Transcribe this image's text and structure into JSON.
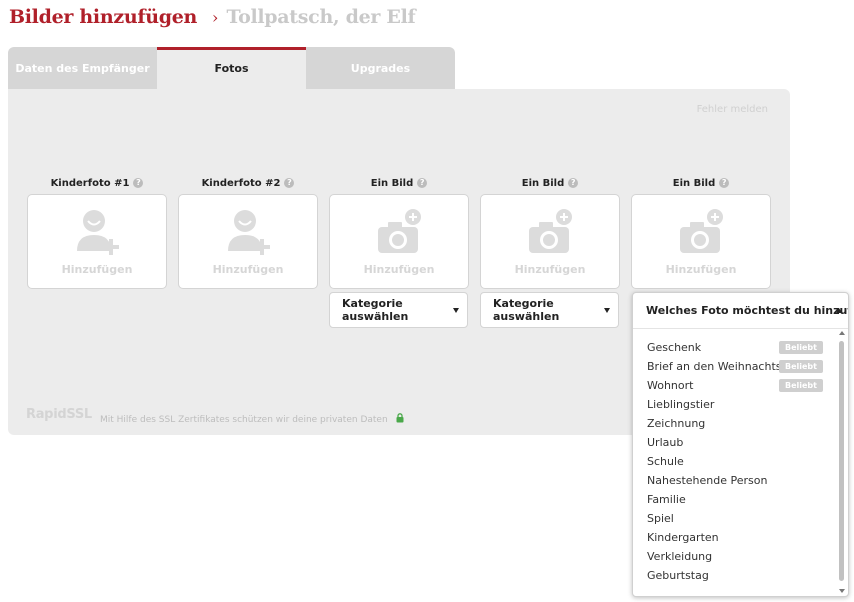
{
  "header": {
    "title": "Bilder hinzufügen",
    "separator": "›",
    "current": "Tollpatsch, der Elf"
  },
  "tabs": [
    {
      "label": "Daten des Empfänger",
      "active": false
    },
    {
      "label": "Fotos",
      "active": true
    },
    {
      "label": "Upgrades",
      "active": false
    }
  ],
  "panel": {
    "report_link": "Fehler melden",
    "help_glyph": "?",
    "slots": [
      {
        "label": "Kinderfoto #1",
        "add_label": "Hinzufügen",
        "icon": "child-photo-add-icon"
      },
      {
        "label": "Kinderfoto #2",
        "add_label": "Hinzufügen",
        "icon": "child-photo-add-icon"
      },
      {
        "label": "Ein Bild",
        "add_label": "Hinzufügen",
        "icon": "camera-add-icon",
        "category": "Kategorie auswählen"
      },
      {
        "label": "Ein Bild",
        "add_label": "Hinzufügen",
        "icon": "camera-add-icon",
        "category": "Kategorie auswählen"
      },
      {
        "label": "Ein Bild",
        "add_label": "Hinzufügen",
        "icon": "camera-add-icon"
      }
    ],
    "ssl_logo": "RapidSSL",
    "ssl_text": "Mit Hilfe des SSL Zertifikates schützen wir deine privaten Daten"
  },
  "dropdown": {
    "selected": "Welches Foto möchtest du hinzufüg…",
    "badge_label": "Beliebt",
    "options": [
      {
        "label": "Geschenk",
        "popular": true
      },
      {
        "label": "Brief an den Weihnachtsmann",
        "popular": true
      },
      {
        "label": "Wohnort",
        "popular": true
      },
      {
        "label": "Lieblingstier",
        "popular": false
      },
      {
        "label": "Zeichnung",
        "popular": false
      },
      {
        "label": "Urlaub",
        "popular": false
      },
      {
        "label": "Schule",
        "popular": false
      },
      {
        "label": "Nahestehende Person",
        "popular": false
      },
      {
        "label": "Familie",
        "popular": false
      },
      {
        "label": "Spiel",
        "popular": false
      },
      {
        "label": "Kindergarten",
        "popular": false
      },
      {
        "label": "Verkleidung",
        "popular": false
      },
      {
        "label": "Geburtstag",
        "popular": false
      }
    ]
  },
  "colors": {
    "brand": "#b0202a",
    "panel_bg": "#ececec",
    "tab_inactive": "#d6d6d6",
    "placeholder_icon": "#dcdcdc",
    "lock": "#4aa84a"
  }
}
